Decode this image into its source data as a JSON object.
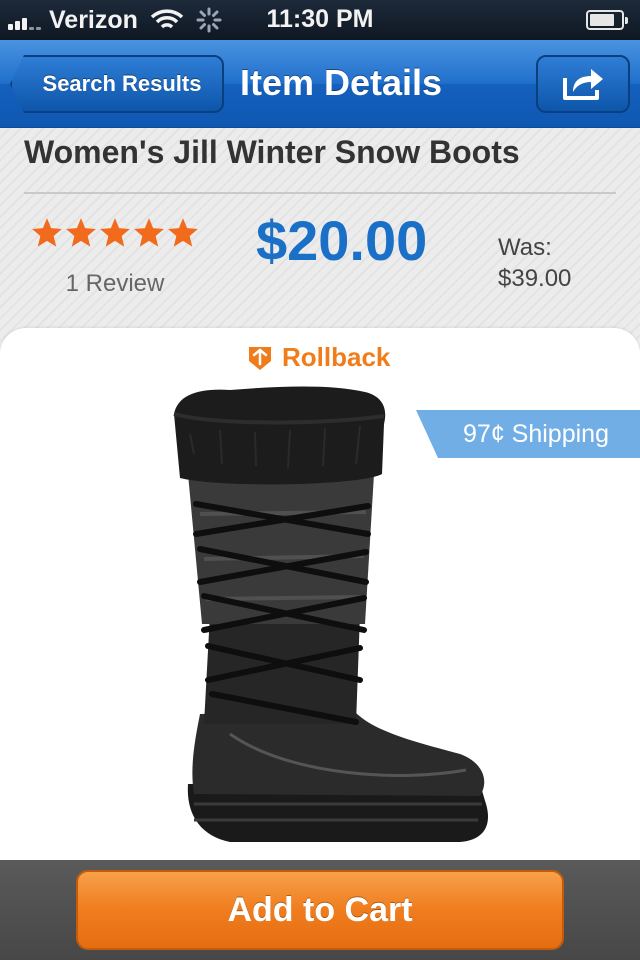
{
  "status_bar": {
    "carrier": "Verizon",
    "time": "11:30 PM",
    "signal_icon": "signal-bars-icon",
    "wifi_icon": "wifi-icon",
    "activity_icon": "loading-spinner-icon",
    "battery_icon": "battery-icon"
  },
  "nav": {
    "back_label": "Search Results",
    "title": "Item Details",
    "share_icon": "share-icon"
  },
  "product": {
    "title": "Women's Jill Winter Snow Boots",
    "rating": 5,
    "rating_max": 5,
    "review_count": "1 Review",
    "price": "$20.00",
    "was_label": "Was:",
    "was_price": "$39.00",
    "badge": "Rollback",
    "badge_icon": "rollback-tag-icon",
    "shipping": "97¢ Shipping",
    "image": "black-snow-boot"
  },
  "actions": {
    "add_to_cart": "Add to Cart"
  },
  "colors": {
    "nav_blue": "#1f6fcb",
    "price_blue": "#1a6fc7",
    "star_orange": "#f26a1b",
    "rollback_orange": "#f07c1a",
    "shipping_blue": "#72aee6",
    "cart_orange": "#ef7d1e"
  }
}
